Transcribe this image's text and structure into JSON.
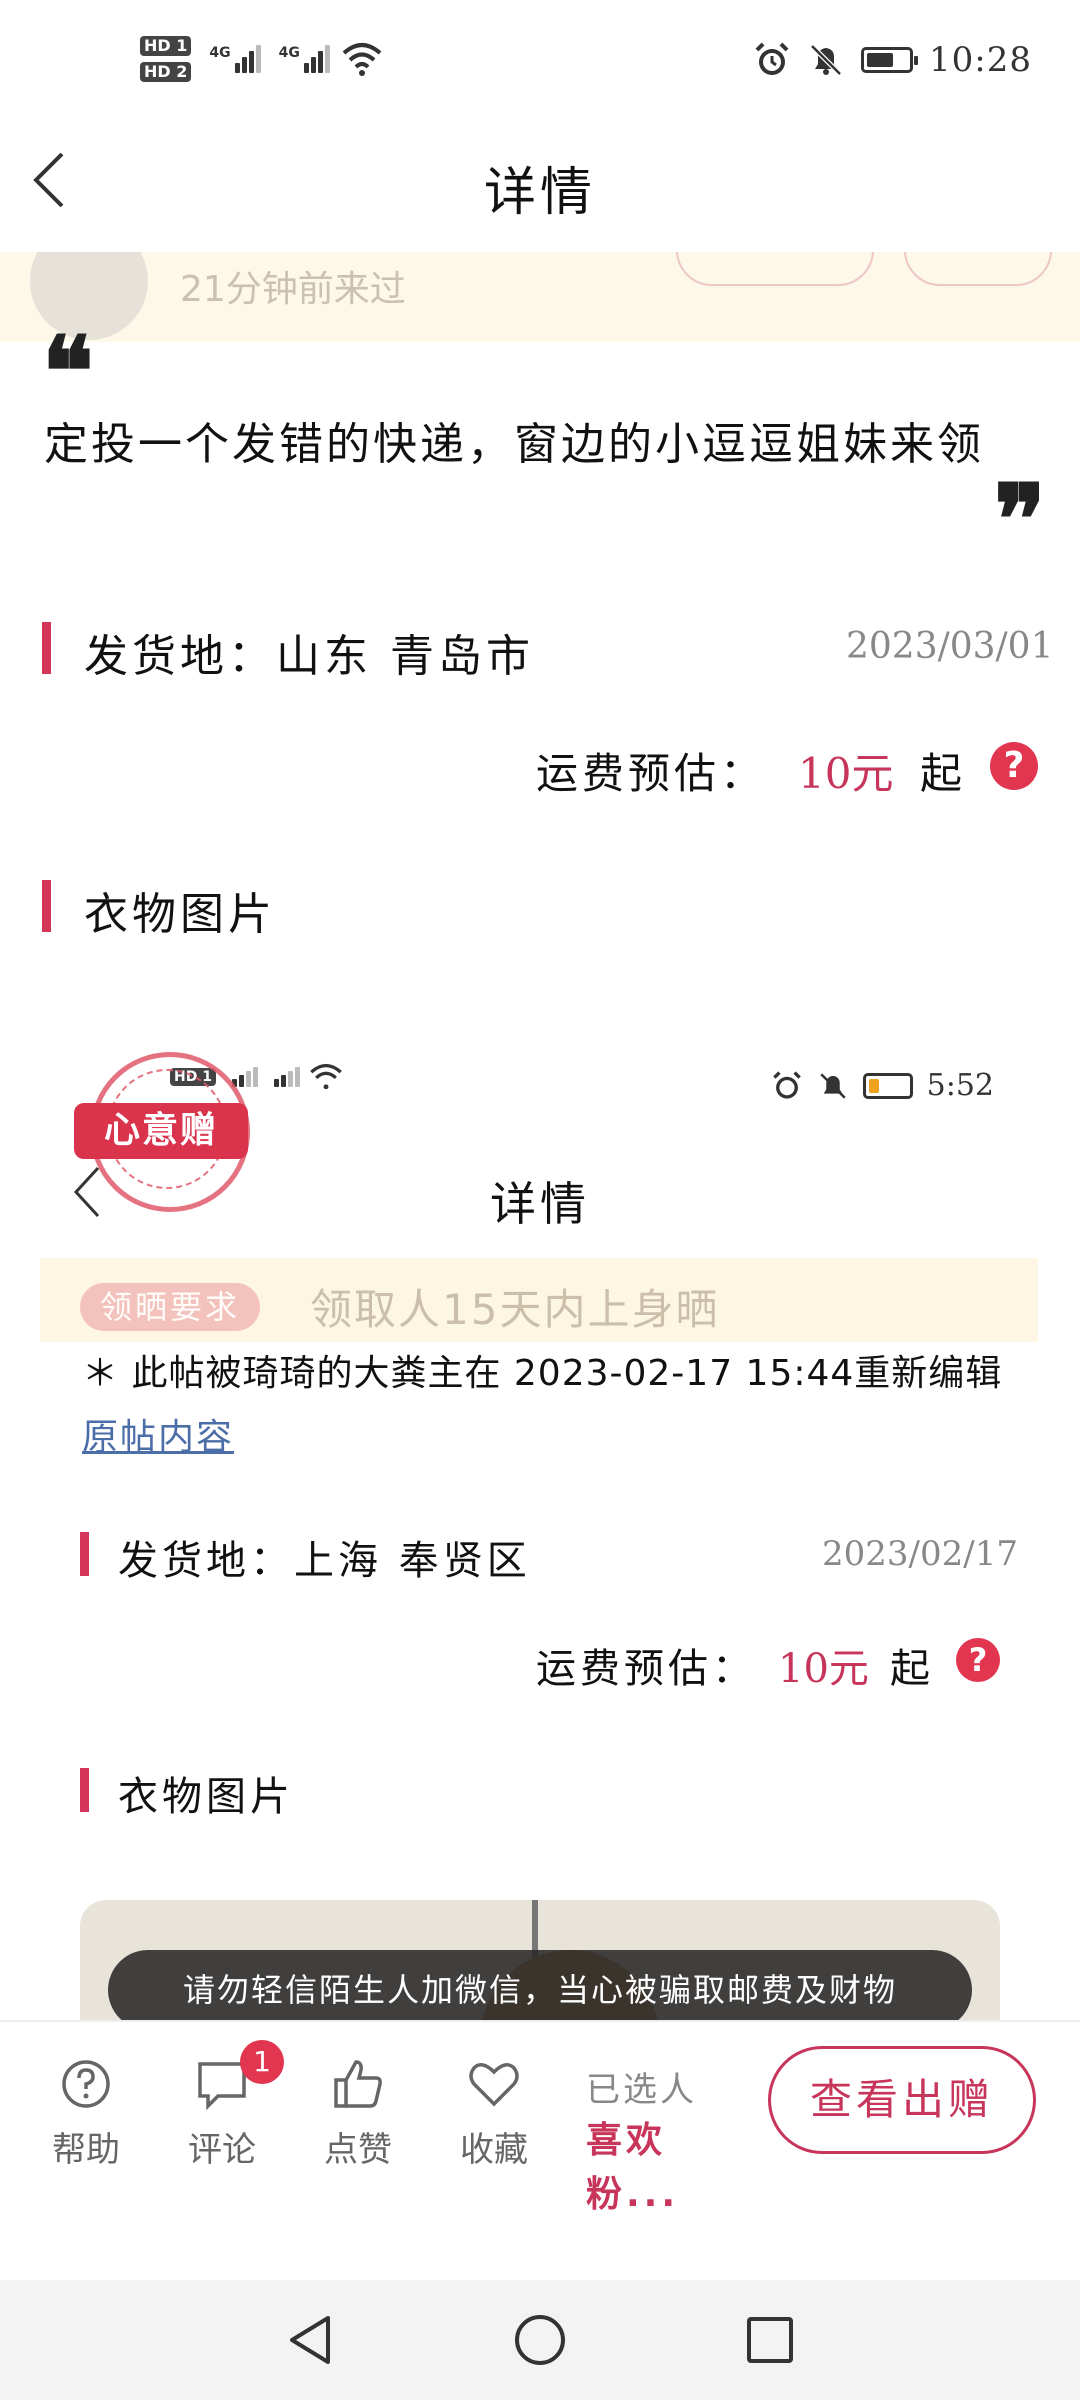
{
  "status_bar": {
    "sim1": "HD",
    "sim1_num": "1",
    "sim2": "HD",
    "sim2_num": "2",
    "net1": "4G",
    "net2": "4G",
    "time": "10:28"
  },
  "header": {
    "title": "详情"
  },
  "faded_user": {
    "visit_text": "21分钟前来过"
  },
  "post": {
    "quote_open": "❝",
    "quote_close": "❞",
    "text": "定投一个发错的快递，窗边的小逗逗姐妹来领",
    "origin_label": "发货地：山东  青岛市",
    "date": "2023/03/01",
    "fee_label": "运费预估：",
    "fee_value": "10元",
    "fee_suffix": "起",
    "help_glyph": "?",
    "clothes_label": "衣物图片"
  },
  "embedded": {
    "status_time": "5:52",
    "stamp_text": "心意赠",
    "title": "详情",
    "requirement_tag": "领晒要求",
    "requirement_text": "领取人15天内上身晒",
    "edit_note": "＊ 此帖被琦琦的大粪主在 2023-02-17  15:44重新编辑",
    "original_link": "原帖内容",
    "origin_label": "发货地：上海  奉贤区",
    "date": "2023/02/17",
    "fee_label": "运费预估：",
    "fee_value": "10元",
    "fee_suffix": "起",
    "help_glyph": "?",
    "clothes_label": "衣物图片",
    "toast": "请勿轻信陌生人加微信，当心被骗取邮费及财物"
  },
  "bottom_bar": {
    "help_label": "帮助",
    "comment_label": "评论",
    "comment_badge": "1",
    "like_label": "点赞",
    "favorite_label": "收藏",
    "selected_title": "已选人",
    "selected_name": "喜欢粉...",
    "cta_label": "查看出赠"
  },
  "colors": {
    "accent": "#c8355a",
    "badge": "#e23650",
    "faded_bg": "#fdf8e8"
  }
}
